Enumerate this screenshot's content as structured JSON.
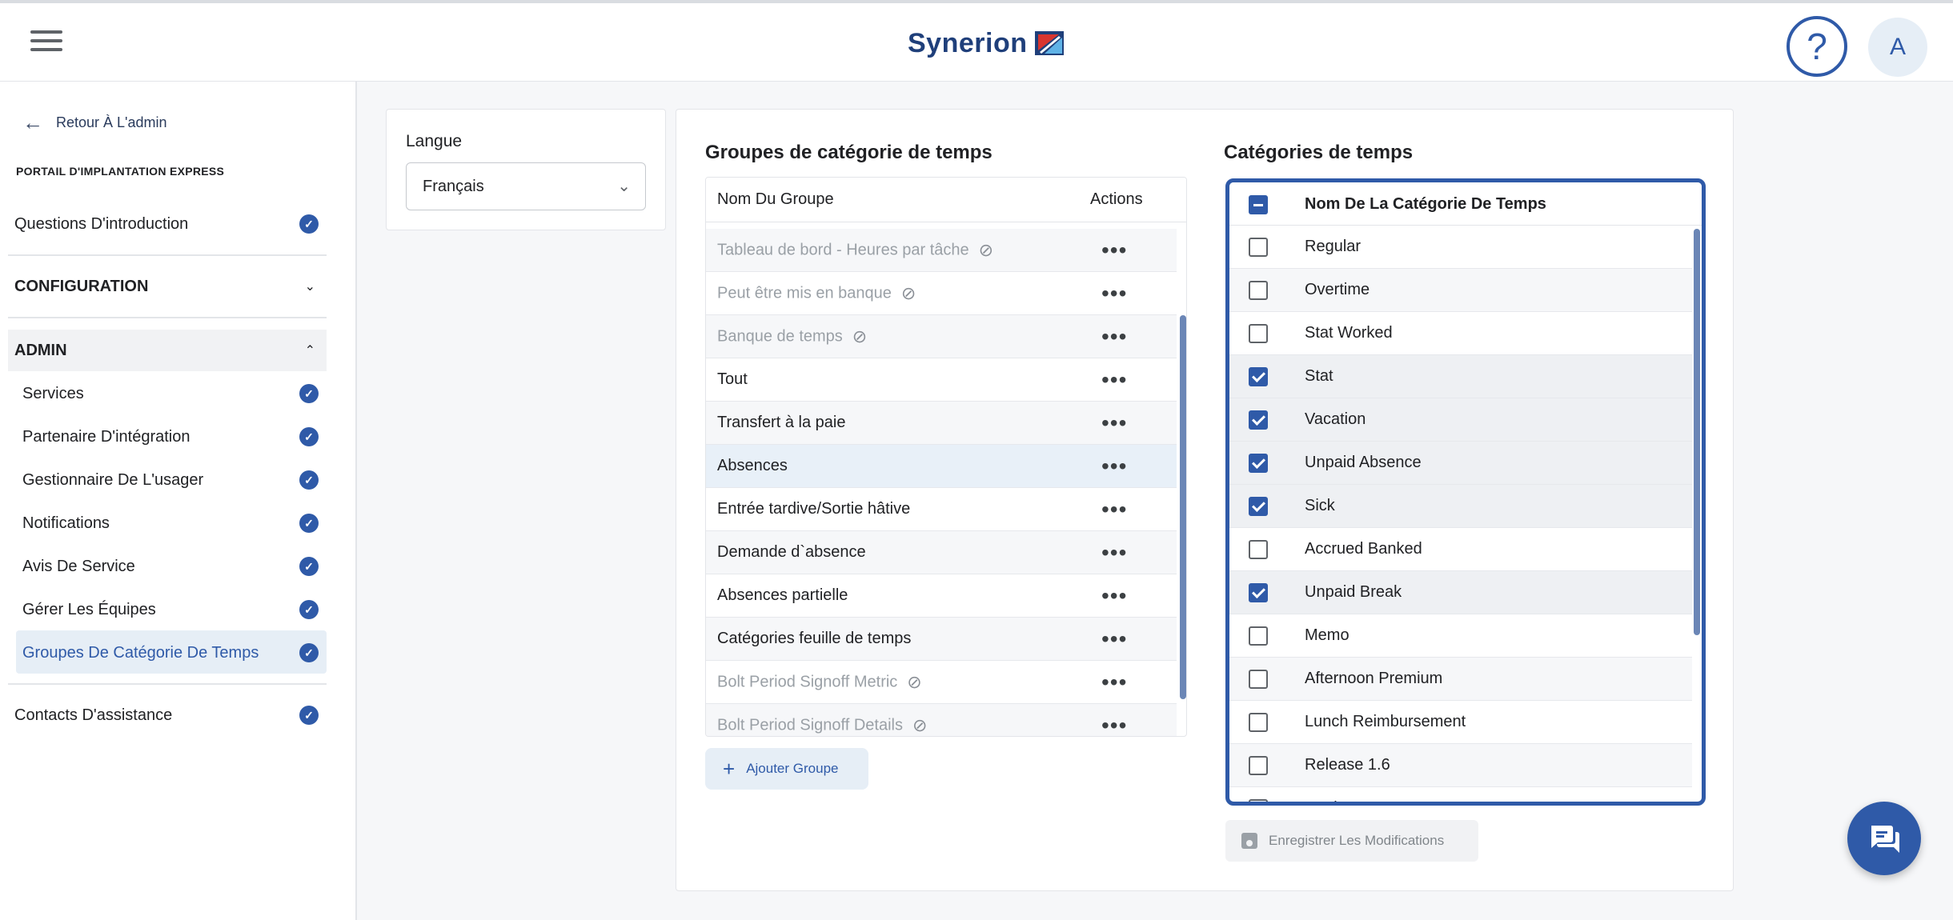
{
  "header": {
    "logo_text": "Synerion",
    "help_symbol": "?",
    "avatar_initial": "A"
  },
  "sidebar": {
    "back_label": "Retour À L'admin",
    "portal_label": "PORTAIL D'IMPLANTATION EXPRESS",
    "intro": "Questions D'introduction",
    "configuration": "CONFIGURATION",
    "admin": "ADMIN",
    "admin_items": [
      {
        "label": "Services"
      },
      {
        "label": "Partenaire D'intégration"
      },
      {
        "label": "Gestionnaire De L'usager"
      },
      {
        "label": "Notifications"
      },
      {
        "label": "Avis De Service"
      },
      {
        "label": "Gérer Les Équipes"
      },
      {
        "label": "Groupes De Catégorie De Temps"
      }
    ],
    "support": "Contacts D'assistance"
  },
  "language": {
    "title": "Langue",
    "selected": "Français"
  },
  "groups": {
    "title": "Groupes de catégorie de temps",
    "col_name": "Nom Du Groupe",
    "col_actions": "Actions",
    "rows": [
      {
        "name": "Tableau de bord - Heures par tâche",
        "hidden": true
      },
      {
        "name": "Peut être mis en banque",
        "hidden": true
      },
      {
        "name": "Banque de temps",
        "hidden": true
      },
      {
        "name": "Tout",
        "hidden": false
      },
      {
        "name": "Transfert à la paie",
        "hidden": false
      },
      {
        "name": "Absences",
        "hidden": false,
        "selected": true
      },
      {
        "name": "Entrée tardive/Sortie hâtive",
        "hidden": false
      },
      {
        "name": "Demande d`absence",
        "hidden": false
      },
      {
        "name": "Absences partielle",
        "hidden": false
      },
      {
        "name": "Catégories feuille de temps",
        "hidden": false
      },
      {
        "name": "Bolt Period Signoff Metric",
        "hidden": true
      },
      {
        "name": "Bolt Period Signoff Details",
        "hidden": true
      }
    ],
    "add_label": "Ajouter Groupe"
  },
  "categories": {
    "title": "Catégories de temps",
    "col_name": "Nom De La Catégorie De Temps",
    "rows": [
      {
        "name": "Regular",
        "checked": false
      },
      {
        "name": "Overtime",
        "checked": false
      },
      {
        "name": "Stat Worked",
        "checked": false
      },
      {
        "name": "Stat",
        "checked": true
      },
      {
        "name": "Vacation",
        "checked": true
      },
      {
        "name": "Unpaid Absence",
        "checked": true
      },
      {
        "name": "Sick",
        "checked": true
      },
      {
        "name": "Accrued Banked",
        "checked": false
      },
      {
        "name": "Unpaid Break",
        "checked": true
      },
      {
        "name": "Memo",
        "checked": false
      },
      {
        "name": "Afternoon Premium",
        "checked": false
      },
      {
        "name": "Lunch Reimbursement",
        "checked": false
      },
      {
        "name": "Release 1.6",
        "checked": false
      },
      {
        "name": "Work Parts",
        "checked": false
      }
    ],
    "save_label": "Enregistrer Les Modifications"
  },
  "icons": {
    "menu": "hamburger-icon",
    "help": "help-icon",
    "back": "arrow-left-icon",
    "check": "check-circle-icon",
    "hidden": "eye-off-icon",
    "more": "more-horizontal-icon",
    "add": "plus-icon",
    "save": "save-icon",
    "chat": "chat-icon"
  },
  "colors": {
    "accent": "#2f5aa8",
    "logo_red": "#d8352f",
    "logo_blue": "#1f3f7a"
  }
}
